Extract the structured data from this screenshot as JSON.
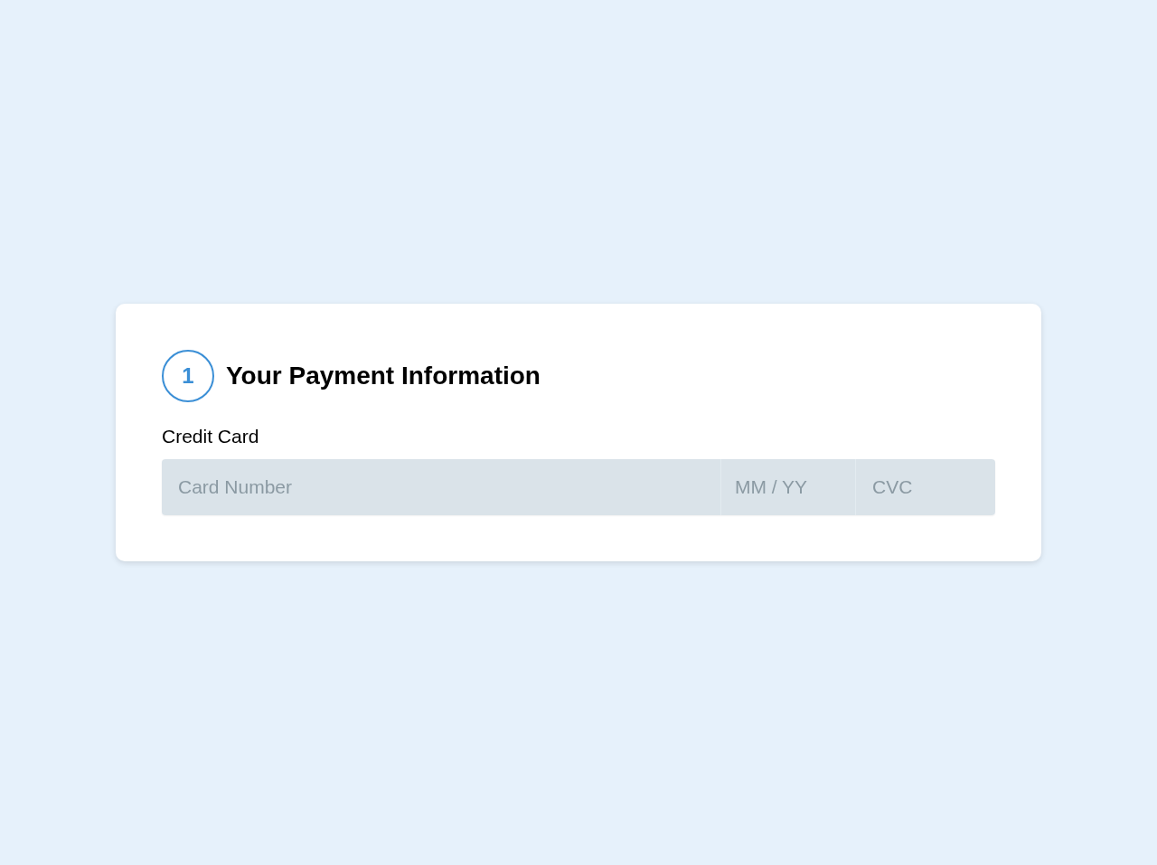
{
  "step": {
    "number": "1",
    "title": "Your Payment Information"
  },
  "card_label": "Credit Card",
  "inputs": [
    {
      "kind": "number",
      "placeholder": "Card Number"
    },
    {
      "kind": "expiry",
      "placeholder": "MM / YY"
    },
    {
      "kind": "cvc",
      "placeholder": "CVC"
    }
  ]
}
